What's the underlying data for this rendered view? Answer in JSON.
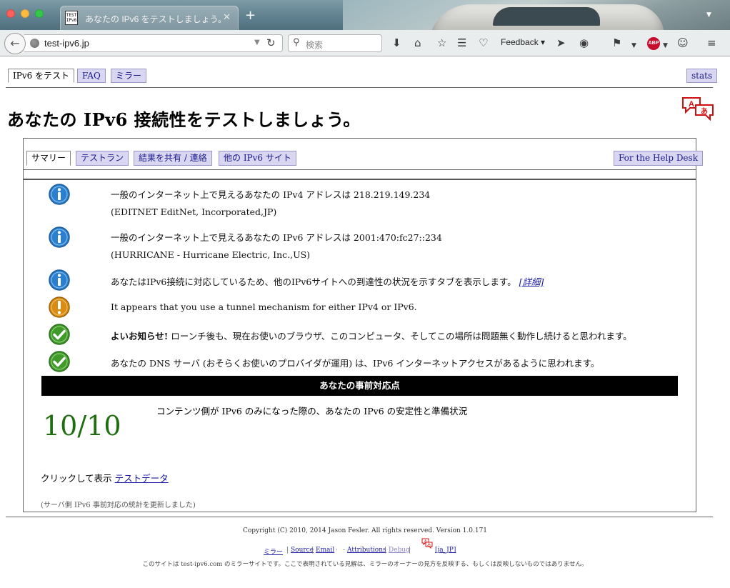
{
  "browser": {
    "tab_title": "あなたの IPv6 をテストしましょう。",
    "tab_favicon_text": "TEST IPv6",
    "url": "test-ipv6.jp",
    "search_placeholder": "検索",
    "feedback_label": "Feedback",
    "abp_label": "ABP"
  },
  "top_tabs": [
    {
      "label": "IPv6 をテスト",
      "active": true
    },
    {
      "label": "FAQ",
      "active": false
    },
    {
      "label": "ミラー",
      "active": false
    }
  ],
  "stats_tab": "stats",
  "page_title": "あなたの IPv6 接続性をテストしましょう。",
  "sub_tabs": [
    {
      "label": "サマリー",
      "active": true
    },
    {
      "label": "テストラン",
      "active": false
    },
    {
      "label": "結果を共有 / 連絡",
      "active": false
    },
    {
      "label": "他の IPv6 サイト",
      "active": false
    }
  ],
  "help_desk_tab": "For the Help Desk",
  "results": [
    {
      "icon": "info",
      "line1": "一般のインターネット上で見えるあなたの IPv4 アドレスは 218.219.149.234",
      "line2": "(EDITNET EditNet, Incorporated,JP)"
    },
    {
      "icon": "info",
      "line1": "一般のインターネット上で見えるあなたの IPv6 アドレスは 2001:470:fc27::234",
      "line2": "(HURRICANE - Hurricane Electric, Inc.,US)"
    },
    {
      "icon": "info",
      "line1": "あなたはIPv6接続に対応しているため、他のIPv6サイトへの到達性の状況を示すタブを表示します。",
      "link": "[詳細]"
    },
    {
      "icon": "warning",
      "line1": "It appears that you use a tunnel mechanism for either IPv4 or IPv6."
    },
    {
      "icon": "ok",
      "bold": "よいお知らせ!",
      "line1": " ローンチ後も、現在お使いのブラウザ、このコンピュータ、そしてこの場所は問題無く動作し続けると思われます。"
    },
    {
      "icon": "ok",
      "line1": "あなたの DNS サーバ (おそらくお使いのプロバイダが運用) は、IPv6 インターネットアクセスがあるように思われます。"
    }
  ],
  "readiness": {
    "heading": "あなたの事前対応点",
    "score": "10/10",
    "caption": "コンテンツ側が IPv6 のみになった際の、あなたの IPv6 の安定性と準備状況"
  },
  "test_data": {
    "prefix": "クリックして表示 ",
    "link": "テストデータ"
  },
  "updated_note": "(サーバ側 IPv6 事前対応の統計を更新しました)",
  "footer": {
    "copyright": "Copyright (C) 2010, 2014 Jason Fesler. All rights reserved. Version 1.0.171",
    "links": {
      "mirror": "ミラー",
      "source": "Source",
      "email": "Email",
      "attributions": "Attributions",
      "debug": "Debug",
      "locale": "[ja_JP]"
    },
    "separators": {
      "bar": "|",
      "dot": "·",
      "dash": "-"
    },
    "mirror_note": "このサイトは test-ipv6.com のミラーサイトです。ここで表明されている見解は、ミラーのオーナーの見方を反映する、もしくは反映しないものではありません。"
  },
  "colors": {
    "info_blue": "#2a7fcf",
    "warning_orange": "#d98b12",
    "ok_green": "#3f9a2a",
    "score_green": "#1e6e10",
    "tab_inactive_bg": "#d8d6f0",
    "link_blue": "#1a1aa6"
  }
}
